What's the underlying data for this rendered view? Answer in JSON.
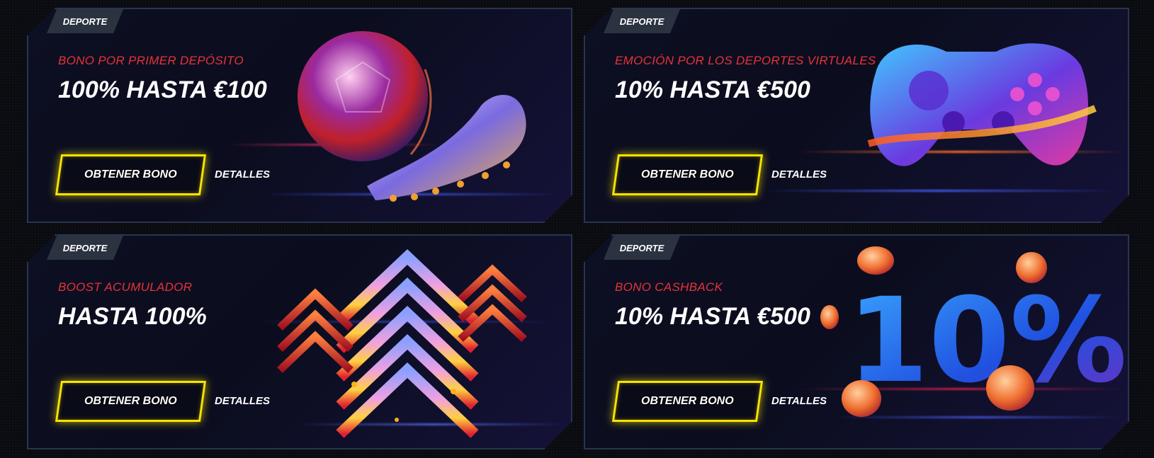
{
  "promos": [
    {
      "badge": "DEPORTE",
      "subtitle": "BONO POR PRIMER DEPÓSITO",
      "title": "100% HASTA €100",
      "cta_label": "OBTENER BONO",
      "details_label": "DETALLES",
      "art": "football-and-boot"
    },
    {
      "badge": "DEPORTE",
      "subtitle": "EMOCIÓN POR LOS DEPORTES VIRTUALES",
      "title": "10% HASTA €500",
      "cta_label": "OBTENER BONO",
      "details_label": "DETALLES",
      "art": "gamepad"
    },
    {
      "badge": "DEPORTE",
      "subtitle": "BOOST ACUMULADOR",
      "title": "HASTA 100%",
      "cta_label": "OBTENER BONO",
      "details_label": "DETALLES",
      "art": "boost-arrows"
    },
    {
      "badge": "DEPORTE",
      "subtitle": "BONO CASHBACK",
      "title": "10% HASTA €500",
      "cta_label": "OBTENER BONO",
      "details_label": "DETALLES",
      "art": "cashback-10-percent",
      "art_text": "10%"
    }
  ],
  "colors": {
    "subtitle": "#e8323a",
    "button_border": "#f7e300",
    "badge_bg": "#2b3240",
    "card_border": "#2a3450"
  }
}
